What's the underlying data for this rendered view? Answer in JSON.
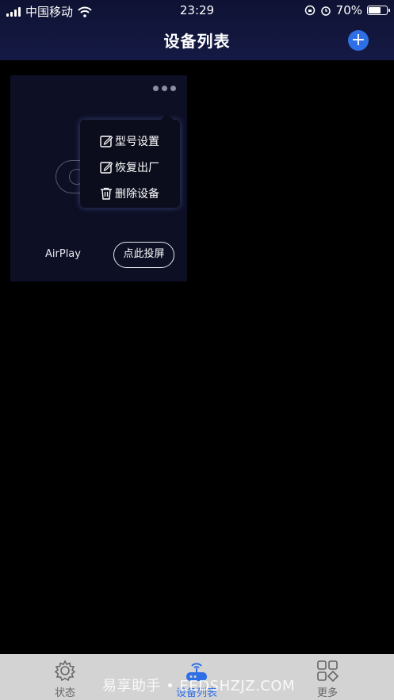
{
  "status_bar": {
    "carrier": "中国移动",
    "time": "23:29",
    "battery_percent": "70%",
    "battery_level": 0.7
  },
  "header": {
    "title": "设备列表",
    "add_icon": "plus-circle-icon"
  },
  "device_card": {
    "name": "AirPlay",
    "cast_button": "点此投屏",
    "more_icon": "ellipsis-icon"
  },
  "popup_menu": {
    "items": [
      {
        "label": "型号设置",
        "icon": "edit-icon"
      },
      {
        "label": "恢复出厂",
        "icon": "edit-icon"
      },
      {
        "label": "删除设备",
        "icon": "trash-icon"
      }
    ]
  },
  "tabbar": {
    "tabs": [
      {
        "label": "状态",
        "icon": "gear-icon"
      },
      {
        "label": "设备列表",
        "icon": "router-icon",
        "active": true
      },
      {
        "label": "更多",
        "icon": "grid-icon"
      }
    ]
  },
  "watermark": "易享助手 • EEDSHZJZ.COM",
  "colors": {
    "accent": "#2f6fe6",
    "header_bg": "#151a45",
    "card_bg": "#0d0f25",
    "tabbar_bg": "#d3d3d3"
  }
}
